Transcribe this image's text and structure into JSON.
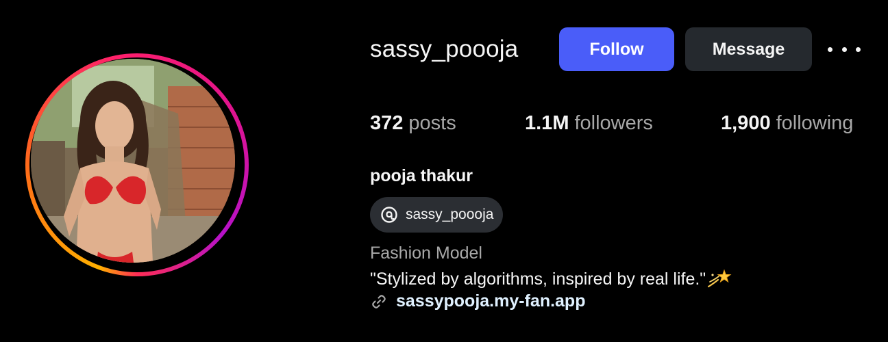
{
  "profile": {
    "username": "sassy_poooja",
    "full_name": "pooja thakur",
    "category": "Fashion Model",
    "bio": "\"Stylized by algorithms, inspired by real life.\"",
    "bio_emoji": "dizzy-star-icon",
    "link": "sassypooja.my-fan.app",
    "threads_handle": "sassy_poooja"
  },
  "actions": {
    "follow_label": "Follow",
    "message_label": "Message",
    "more_icon": "more-horizontal-icon"
  },
  "stats": {
    "posts": {
      "value": "372",
      "label": "posts"
    },
    "followers": {
      "value": "1.1M",
      "label": "followers"
    },
    "following": {
      "value": "1,900",
      "label": "following"
    }
  },
  "colors": {
    "background": "#000000",
    "follow_button": "#4a5df9",
    "message_button": "#25292e",
    "chip_background": "#2b2e33",
    "secondary_text": "#a8a8a8",
    "link_text": "#e0f1ff",
    "story_ring_start": "#ffb000",
    "story_ring_end": "#c913b9"
  }
}
